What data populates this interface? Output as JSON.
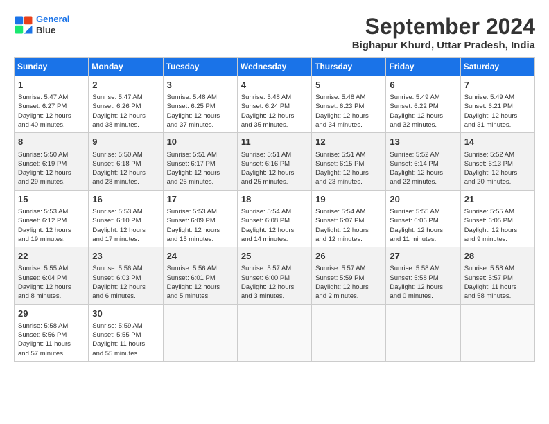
{
  "logo": {
    "line1": "General",
    "line2": "Blue"
  },
  "title": "September 2024",
  "subtitle": "Bighapur Khurd, Uttar Pradesh, India",
  "headers": [
    "Sunday",
    "Monday",
    "Tuesday",
    "Wednesday",
    "Thursday",
    "Friday",
    "Saturday"
  ],
  "weeks": [
    [
      {
        "day": "1",
        "info": "Sunrise: 5:47 AM\nSunset: 6:27 PM\nDaylight: 12 hours\nand 40 minutes."
      },
      {
        "day": "2",
        "info": "Sunrise: 5:47 AM\nSunset: 6:26 PM\nDaylight: 12 hours\nand 38 minutes."
      },
      {
        "day": "3",
        "info": "Sunrise: 5:48 AM\nSunset: 6:25 PM\nDaylight: 12 hours\nand 37 minutes."
      },
      {
        "day": "4",
        "info": "Sunrise: 5:48 AM\nSunset: 6:24 PM\nDaylight: 12 hours\nand 35 minutes."
      },
      {
        "day": "5",
        "info": "Sunrise: 5:48 AM\nSunset: 6:23 PM\nDaylight: 12 hours\nand 34 minutes."
      },
      {
        "day": "6",
        "info": "Sunrise: 5:49 AM\nSunset: 6:22 PM\nDaylight: 12 hours\nand 32 minutes."
      },
      {
        "day": "7",
        "info": "Sunrise: 5:49 AM\nSunset: 6:21 PM\nDaylight: 12 hours\nand 31 minutes."
      }
    ],
    [
      {
        "day": "8",
        "info": "Sunrise: 5:50 AM\nSunset: 6:19 PM\nDaylight: 12 hours\nand 29 minutes."
      },
      {
        "day": "9",
        "info": "Sunrise: 5:50 AM\nSunset: 6:18 PM\nDaylight: 12 hours\nand 28 minutes."
      },
      {
        "day": "10",
        "info": "Sunrise: 5:51 AM\nSunset: 6:17 PM\nDaylight: 12 hours\nand 26 minutes."
      },
      {
        "day": "11",
        "info": "Sunrise: 5:51 AM\nSunset: 6:16 PM\nDaylight: 12 hours\nand 25 minutes."
      },
      {
        "day": "12",
        "info": "Sunrise: 5:51 AM\nSunset: 6:15 PM\nDaylight: 12 hours\nand 23 minutes."
      },
      {
        "day": "13",
        "info": "Sunrise: 5:52 AM\nSunset: 6:14 PM\nDaylight: 12 hours\nand 22 minutes."
      },
      {
        "day": "14",
        "info": "Sunrise: 5:52 AM\nSunset: 6:13 PM\nDaylight: 12 hours\nand 20 minutes."
      }
    ],
    [
      {
        "day": "15",
        "info": "Sunrise: 5:53 AM\nSunset: 6:12 PM\nDaylight: 12 hours\nand 19 minutes."
      },
      {
        "day": "16",
        "info": "Sunrise: 5:53 AM\nSunset: 6:10 PM\nDaylight: 12 hours\nand 17 minutes."
      },
      {
        "day": "17",
        "info": "Sunrise: 5:53 AM\nSunset: 6:09 PM\nDaylight: 12 hours\nand 15 minutes."
      },
      {
        "day": "18",
        "info": "Sunrise: 5:54 AM\nSunset: 6:08 PM\nDaylight: 12 hours\nand 14 minutes."
      },
      {
        "day": "19",
        "info": "Sunrise: 5:54 AM\nSunset: 6:07 PM\nDaylight: 12 hours\nand 12 minutes."
      },
      {
        "day": "20",
        "info": "Sunrise: 5:55 AM\nSunset: 6:06 PM\nDaylight: 12 hours\nand 11 minutes."
      },
      {
        "day": "21",
        "info": "Sunrise: 5:55 AM\nSunset: 6:05 PM\nDaylight: 12 hours\nand 9 minutes."
      }
    ],
    [
      {
        "day": "22",
        "info": "Sunrise: 5:55 AM\nSunset: 6:04 PM\nDaylight: 12 hours\nand 8 minutes."
      },
      {
        "day": "23",
        "info": "Sunrise: 5:56 AM\nSunset: 6:03 PM\nDaylight: 12 hours\nand 6 minutes."
      },
      {
        "day": "24",
        "info": "Sunrise: 5:56 AM\nSunset: 6:01 PM\nDaylight: 12 hours\nand 5 minutes."
      },
      {
        "day": "25",
        "info": "Sunrise: 5:57 AM\nSunset: 6:00 PM\nDaylight: 12 hours\nand 3 minutes."
      },
      {
        "day": "26",
        "info": "Sunrise: 5:57 AM\nSunset: 5:59 PM\nDaylight: 12 hours\nand 2 minutes."
      },
      {
        "day": "27",
        "info": "Sunrise: 5:58 AM\nSunset: 5:58 PM\nDaylight: 12 hours\nand 0 minutes."
      },
      {
        "day": "28",
        "info": "Sunrise: 5:58 AM\nSunset: 5:57 PM\nDaylight: 11 hours\nand 58 minutes."
      }
    ],
    [
      {
        "day": "29",
        "info": "Sunrise: 5:58 AM\nSunset: 5:56 PM\nDaylight: 11 hours\nand 57 minutes."
      },
      {
        "day": "30",
        "info": "Sunrise: 5:59 AM\nSunset: 5:55 PM\nDaylight: 11 hours\nand 55 minutes."
      },
      {
        "day": "",
        "info": ""
      },
      {
        "day": "",
        "info": ""
      },
      {
        "day": "",
        "info": ""
      },
      {
        "day": "",
        "info": ""
      },
      {
        "day": "",
        "info": ""
      }
    ]
  ]
}
